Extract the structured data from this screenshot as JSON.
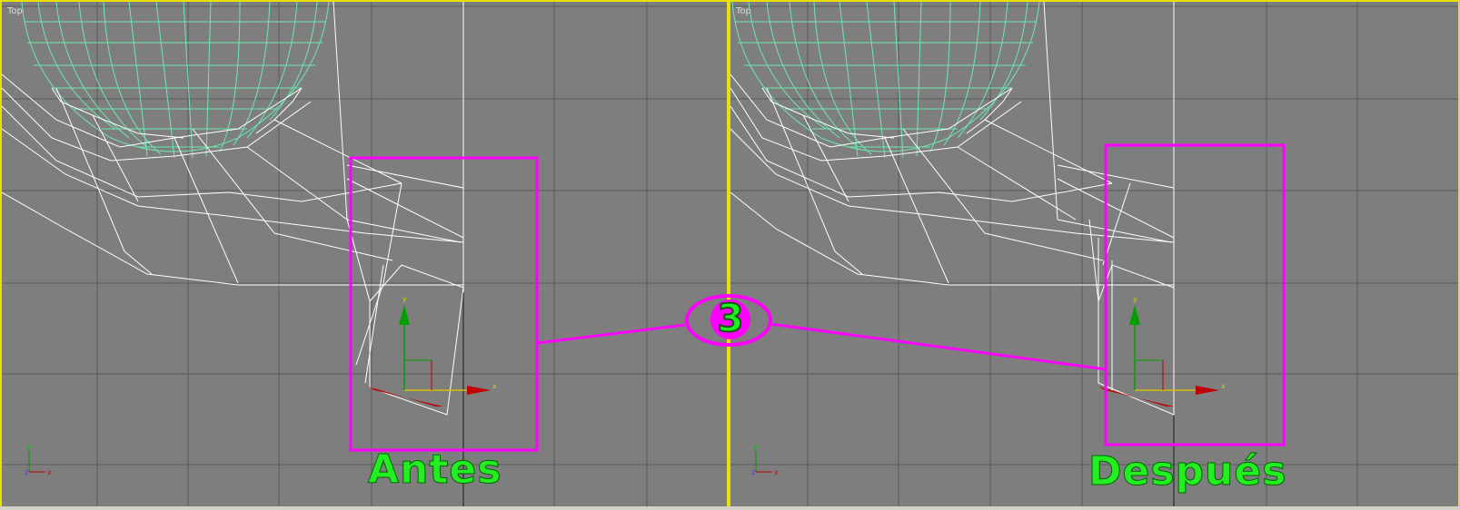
{
  "viewports": {
    "left": {
      "label": "Top",
      "caption": "Antes"
    },
    "right": {
      "label": "Top",
      "caption": "Después"
    }
  },
  "step_number": "3",
  "colors": {
    "viewport_bg": "#7e7e7e",
    "viewport_border": "#e8e000",
    "grid": "#5a5a5a",
    "wire": "#ffffff",
    "sphere_wire": "#6ee8b0",
    "highlight": "#ff00ff",
    "caption": "#22ee22",
    "axis_y": "#00a000",
    "axis_x": "#c00000"
  },
  "gizmo": {
    "x_label": "x",
    "y_label": "y",
    "z_label": "z"
  },
  "icons": [
    "transform-gizmo-icon",
    "world-axis-icon"
  ]
}
